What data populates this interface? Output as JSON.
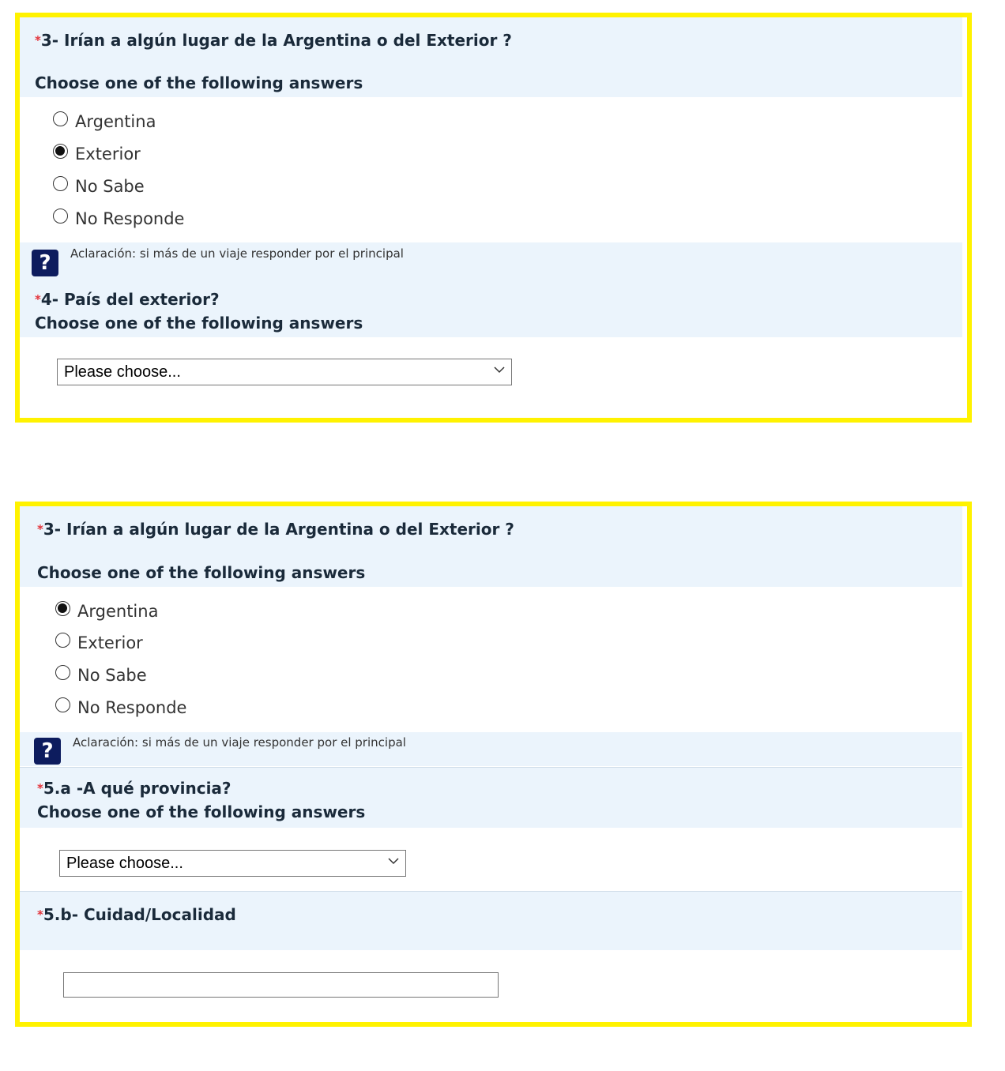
{
  "panel_a": {
    "q3": {
      "required_mark": "*",
      "title": "3- Irían a algún lugar de la Argentina o del Exterior ?",
      "subtitle": "Choose one of the following answers",
      "options": [
        {
          "label": "Argentina",
          "selected": false
        },
        {
          "label": "Exterior",
          "selected": true
        },
        {
          "label": "No Sabe",
          "selected": false
        },
        {
          "label": "No Responde",
          "selected": false
        }
      ]
    },
    "help": {
      "icon": "?",
      "text": "Aclaración: si más de un viaje responder por el principal"
    },
    "q4": {
      "required_mark": "*",
      "title": "4- País del exterior?",
      "subtitle": "Choose one of the following answers",
      "select_value": "Please choose..."
    }
  },
  "panel_b": {
    "q3": {
      "required_mark": "*",
      "title": "3- Irían a algún lugar de la Argentina o del Exterior ?",
      "subtitle": "Choose one of the following answers",
      "options": [
        {
          "label": "Argentina",
          "selected": true
        },
        {
          "label": "Exterior",
          "selected": false
        },
        {
          "label": "No Sabe",
          "selected": false
        },
        {
          "label": "No Responde",
          "selected": false
        }
      ]
    },
    "help": {
      "icon": "?",
      "text": "Aclaración: si más de un viaje responder por el principal"
    },
    "q5a": {
      "required_mark": "*",
      "title": "5.a -A qué provincia?",
      "subtitle": "Choose one of the following answers",
      "select_value": "Please choose..."
    },
    "q5b": {
      "required_mark": "*",
      "title": "5.b- Cuidad/Localidad",
      "input_value": ""
    }
  },
  "colors": {
    "highlight_border": "#fff200",
    "question_band": "#ebf4fc",
    "required": "#e3333b",
    "help_icon": "#0d1c5e"
  }
}
